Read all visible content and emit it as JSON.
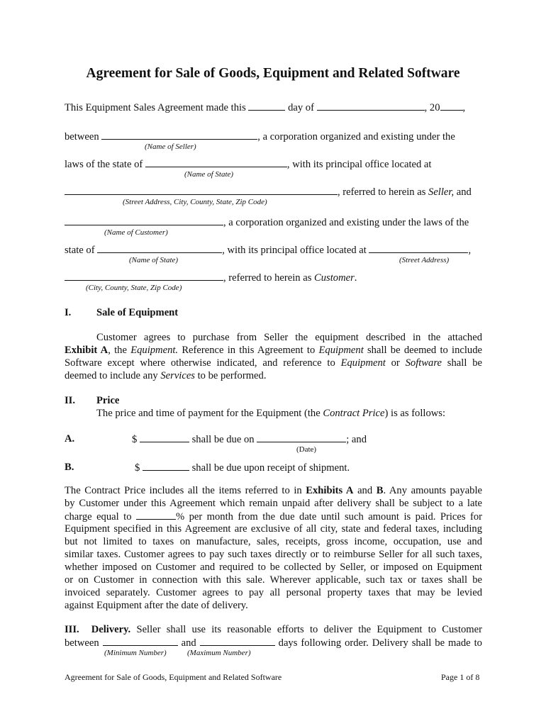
{
  "document": {
    "title": "Agreement for Sale of Goods, Equipment and Related Software",
    "intro": {
      "made_this": "This Equipment Sales Agreement made this",
      "day_of": "day of",
      "year_prefix": ", 20",
      "comma": ","
    },
    "seller": {
      "between": "between",
      "corp_text": ", a corporation organized and existing under the",
      "name_caption": "(Name of Seller)",
      "laws_of_state": "laws of the state of",
      "office_text": ", with its principal office located at",
      "state_caption": "(Name of State)",
      "referred_text": ", referred to herein as ",
      "referred_role": "Seller,",
      "referred_and": " and",
      "address_caption": "(Street Address, City, County, State, Zip Code)"
    },
    "customer": {
      "corp_text": ", a corporation organized and existing under the laws of the",
      "name_caption": "(Name of Customer)",
      "state_of": "state of",
      "office_text": ", with its principal office located at",
      "comma": ",",
      "state_caption": "(Name of State)",
      "street_caption": "(Street Address)",
      "referred_text": ", referred to herein as ",
      "referred_role": "Customer",
      "period": ".",
      "city_caption": "(City, County, State, Zip Code)"
    },
    "section1": {
      "number": "I.",
      "heading": "Sale of Equipment",
      "lines": [
        "Customer agrees to purchase from Seller the equipment described in the attached",
        "Exhibit A|, the |Equipment.| Reference in this Agreement to |Equipment| shall be deemed to include",
        "Software except where otherwise indicated, and reference to |Equipment| or |Software| shall be",
        "deemed to include any |Services| to be performed."
      ],
      "line2": {
        "b1": "Exhibit A",
        "t1": ", the ",
        "i1": "Equipment.",
        "t2": " Reference in this Agreement to ",
        "i2": "Equipment",
        "t3": " shall be deemed to include"
      },
      "line3": {
        "t1": "Software except where otherwise indicated, and reference to ",
        "i1": "Equipment",
        "t2": " or ",
        "i2": "Software",
        "t3": " shall be"
      },
      "line4": {
        "t1": "deemed to include any ",
        "i1": "Services",
        "t2": " to be performed."
      }
    },
    "section2": {
      "number": "II.",
      "heading": "Price",
      "intro_t1": "The price and time of payment for the Equipment (the ",
      "intro_i1": "Contract Price",
      "intro_t2": ") is as follows:",
      "itemA": {
        "label": "A.",
        "dollar": "$",
        "due_on": "shall be due on",
        "and": "; and",
        "date_caption": "(Date)"
      },
      "itemB": {
        "label": "B.",
        "dollar": "$",
        "due_text": "shall be due upon receipt of shipment."
      },
      "para": {
        "l1_t1": "The Contract Price includes all the items referred to in ",
        "l1_b1": "Exhibits A",
        "l1_t2": " and ",
        "l1_b2": "B",
        "l1_t3": ". Any amounts payable",
        "l2": "by Customer under this Agreement which remain unpaid after delivery shall be subject to a late",
        "l3_t1": "charge equal to ",
        "l3_t2": "% per month from the due date until such amount is paid. Prices for",
        "l4": "Equipment specified in this Agreement are exclusive of all city, state and federal taxes, including",
        "l5": "but not limited to taxes on manufacture, sales, receipts, gross income, occupation, use and",
        "l6": "similar taxes. Customer agrees to pay such taxes directly or to reimburse Seller for all such taxes,",
        "l7": "whether imposed on Customer and required to be collected by Seller, or imposed on Equipment",
        "l8": "or on Customer in connection with this sale. Wherever applicable, such tax or taxes shall be",
        "l9": "invoiced separately. Customer agrees to pay all personal property taxes that may be levied",
        "l10": "against Equipment after the date of delivery."
      }
    },
    "section3": {
      "number": "III.",
      "heading": "Delivery.",
      "l1": " Seller shall use its reasonable efforts to deliver the Equipment to Customer",
      "between": "between",
      "and": "and",
      "l2_tail": "days following order. Delivery shall be made to",
      "min_caption": "(Minimum Number)",
      "max_caption": "(Maximum Number)"
    },
    "footer": {
      "title": "Agreement for Sale of Goods, Equipment and Related Software",
      "page": "Page 1 of 8"
    }
  }
}
